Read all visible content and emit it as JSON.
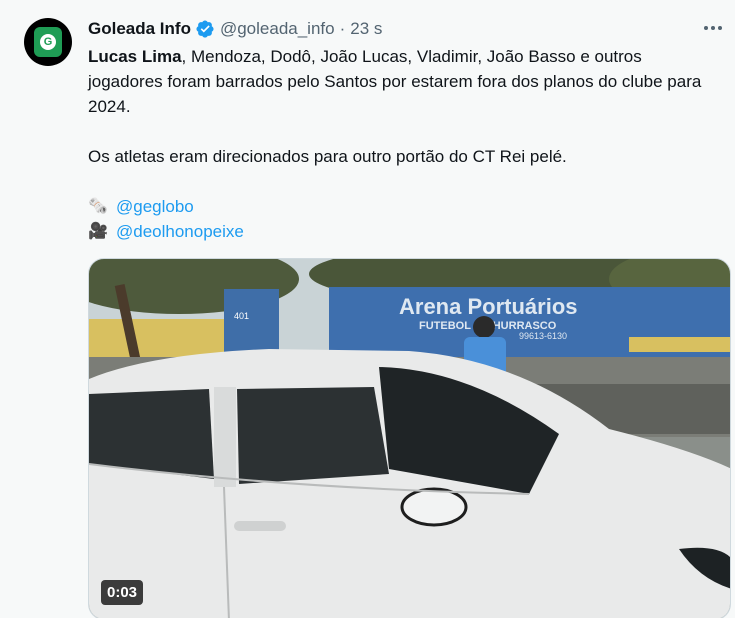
{
  "author": {
    "name": "Goleada Info",
    "handle": "@goleada_info",
    "separator": "·",
    "time": "23 s"
  },
  "tweet": {
    "line1_bold": "Lucas Lima",
    "line1_rest": ", Mendoza, Dodô, João Lucas, Vladimir, João Basso e outros jogadores foram barrados pelo Santos por estarem fora dos planos do clube para 2024.",
    "line2": "Os atletas eram direcionados para outro portão do CT Rei pelé.",
    "link1_emoji": "🗞️",
    "link1": "@geglobo",
    "link2_emoji": "🎥",
    "link2": "@deolhonopeixe"
  },
  "video": {
    "duration": "0:03",
    "sign_title": "Arena Portuários",
    "sign_sub": "FUTEBOL  &  CHURRASCO",
    "sign_phone": "99613-6130",
    "house_number": "401"
  },
  "colors": {
    "link": "#1d9bf0",
    "verified": "#1d9bf0",
    "background": "#f7f9f9"
  }
}
